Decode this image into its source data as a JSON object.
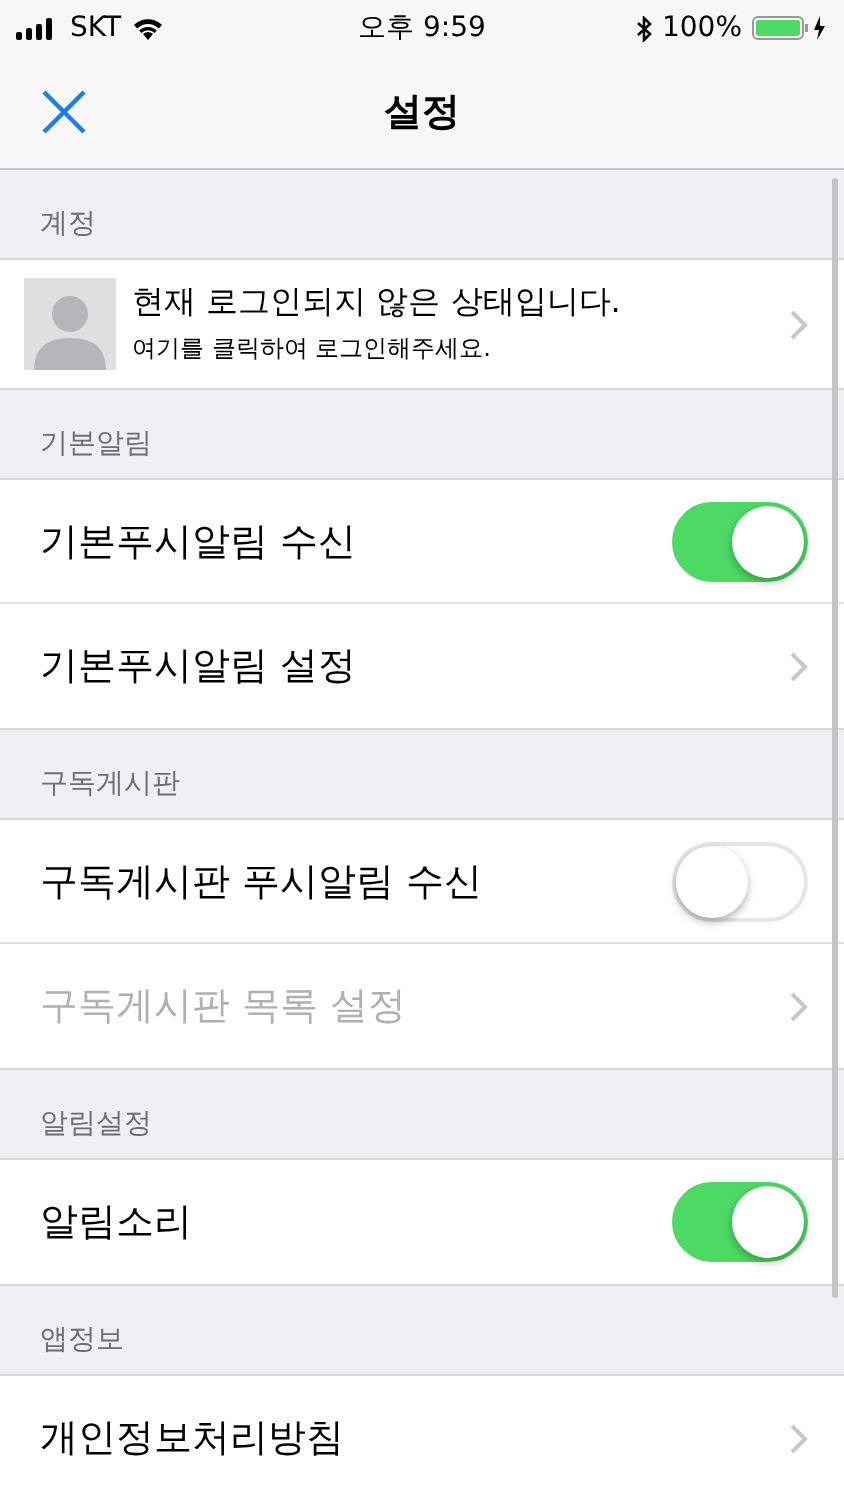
{
  "status_bar": {
    "carrier": "SKT",
    "time": "오후 9:59",
    "battery": "100%"
  },
  "nav": {
    "title": "설정"
  },
  "sections": [
    {
      "header": "계정",
      "rows": [
        {
          "kind": "account",
          "title": "현재 로그인되지 않은 상태입니다.",
          "subtitle": "여기를 클릭하여 로그인해주세요."
        }
      ]
    },
    {
      "header": "기본알림",
      "rows": [
        {
          "kind": "toggle",
          "label": "기본푸시알림 수신",
          "on": true,
          "disabled": false
        },
        {
          "kind": "link",
          "label": "기본푸시알림 설정",
          "disabled": false
        }
      ]
    },
    {
      "header": "구독게시판",
      "rows": [
        {
          "kind": "toggle",
          "label": "구독게시판 푸시알림 수신",
          "on": false,
          "disabled": false
        },
        {
          "kind": "link",
          "label": "구독게시판 목록 설정",
          "disabled": true
        }
      ]
    },
    {
      "header": "알림설정",
      "rows": [
        {
          "kind": "toggle",
          "label": "알림소리",
          "on": true,
          "disabled": false
        }
      ]
    },
    {
      "header": "앱정보",
      "rows": [
        {
          "kind": "link",
          "label": "개인정보처리방침",
          "disabled": false
        }
      ]
    }
  ]
}
